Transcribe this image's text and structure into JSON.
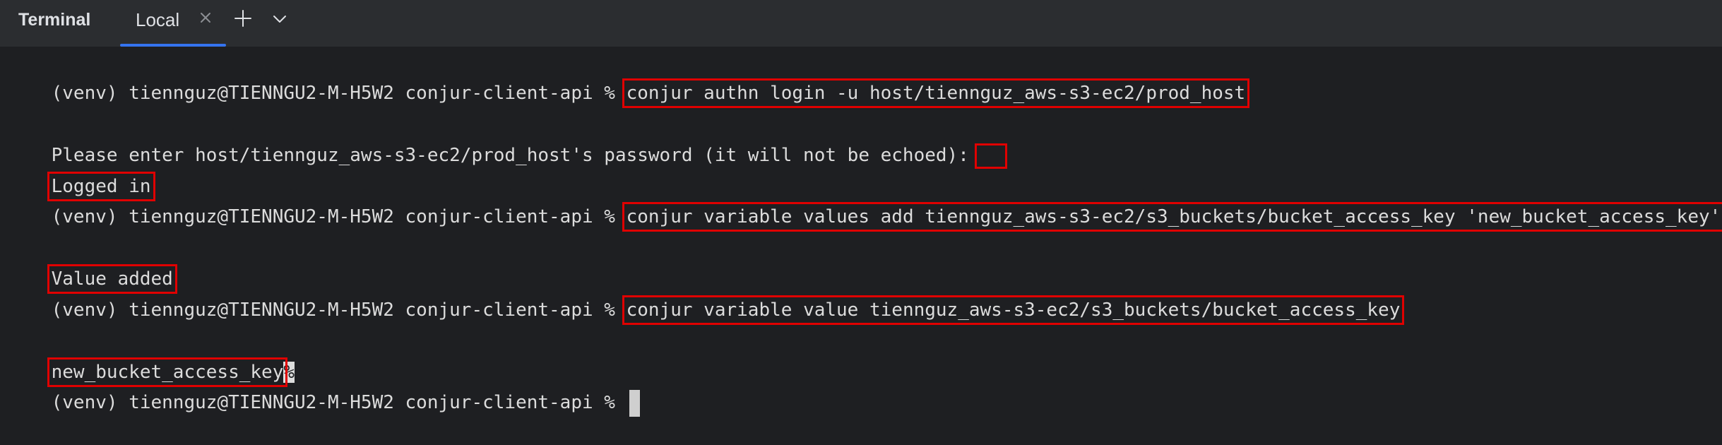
{
  "toolwindow": {
    "title": "Terminal",
    "tabs": [
      {
        "label": "Local",
        "active": true
      }
    ]
  },
  "icons": {
    "close": "close-icon",
    "add": "plus-icon",
    "menu": "chevron-down-icon"
  },
  "colors": {
    "background": "#1e1f22",
    "tabbar": "#2b2d30",
    "accent": "#3574f0",
    "highlight": "#e00000"
  },
  "terminal": {
    "prompt": "(venv) tiennguz@TIENNGU2-M-H5W2 conjur-client-api % ",
    "cmd1": "conjur authn login -u host/tiennguz_aws-s3-ec2/prod_host",
    "password_prompt": "Please enter host/tiennguz_aws-s3-ec2/prod_host's password (it will not be echoed):",
    "out1": "Logged in",
    "cmd2": "conjur variable values add tiennguz_aws-s3-ec2/s3_buckets/bucket_access_key 'new_bucket_access_key'",
    "out2": "Value added",
    "cmd3": "conjur variable value tiennguz_aws-s3-ec2/s3_buckets/bucket_access_key",
    "out3": "new_bucket_access_key",
    "no_newline_marker": "%"
  }
}
